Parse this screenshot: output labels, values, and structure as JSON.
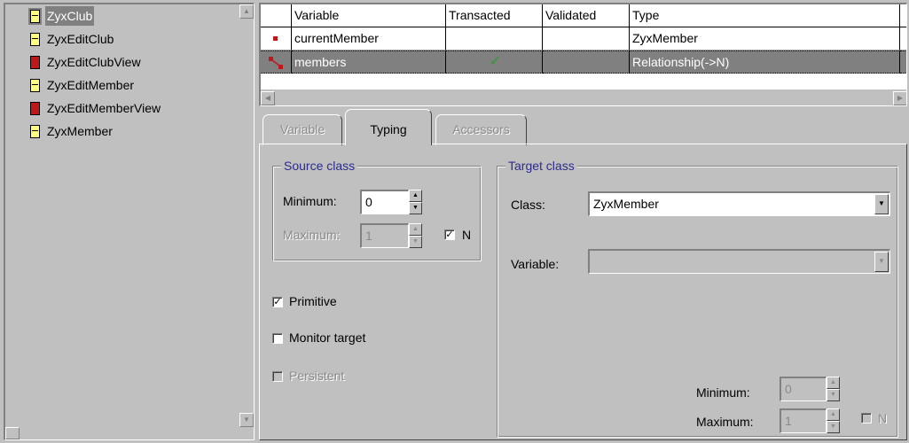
{
  "class_list": {
    "items": [
      {
        "label": "ZyxClub",
        "icon": "class-yellow-icon",
        "selected": true
      },
      {
        "label": "ZyxEditClub",
        "icon": "class-yellow-icon",
        "selected": false
      },
      {
        "label": "ZyxEditClubView",
        "icon": "class-red-icon",
        "selected": false
      },
      {
        "label": "ZyxEditMember",
        "icon": "class-yellow-icon",
        "selected": false
      },
      {
        "label": "ZyxEditMemberView",
        "icon": "class-red-icon",
        "selected": false
      },
      {
        "label": "ZyxMember",
        "icon": "class-yellow-icon",
        "selected": false
      }
    ]
  },
  "variables_table": {
    "headers": [
      "Variable",
      "Transacted",
      "Validated",
      "Type"
    ],
    "rows": [
      {
        "variable": "currentMember",
        "transacted": "",
        "validated": "",
        "type": "ZyxMember",
        "selected": false
      },
      {
        "variable": "members",
        "transacted": "✓",
        "validated": "",
        "type": "Relationship(->N)",
        "selected": true
      }
    ]
  },
  "tabs": [
    {
      "label": "Variable",
      "state": "disabled"
    },
    {
      "label": "Typing",
      "state": "active"
    },
    {
      "label": "Accessors",
      "state": "disabled"
    }
  ],
  "source_class": {
    "title": "Source class",
    "minimum_label": "Minimum:",
    "minimum_value": "0",
    "maximum_label": "Maximum:",
    "maximum_value": "1",
    "n_label": "N",
    "n_checked": true
  },
  "options": {
    "primitive_label": "Primitive",
    "primitive_checked": true,
    "monitor_label": "Monitor target",
    "monitor_checked": false,
    "persistent_label": "Persistent",
    "persistent_checked": false
  },
  "target_class": {
    "title": "Target class",
    "class_label": "Class:",
    "class_value": "ZyxMember",
    "variable_label": "Variable:",
    "variable_value": "",
    "minimum_label": "Minimum:",
    "minimum_value": "0",
    "maximum_label": "Maximum:",
    "maximum_value": "1",
    "n_label": "N",
    "n_checked": false
  },
  "colors": {
    "window_bg": "#c0c0c0",
    "selection_bg": "#808080",
    "group_title": "#2b2b8e",
    "class_icon_yellow": "#ffff80",
    "class_icon_red": "#c01818",
    "check_mark": "#2e9a2e"
  }
}
